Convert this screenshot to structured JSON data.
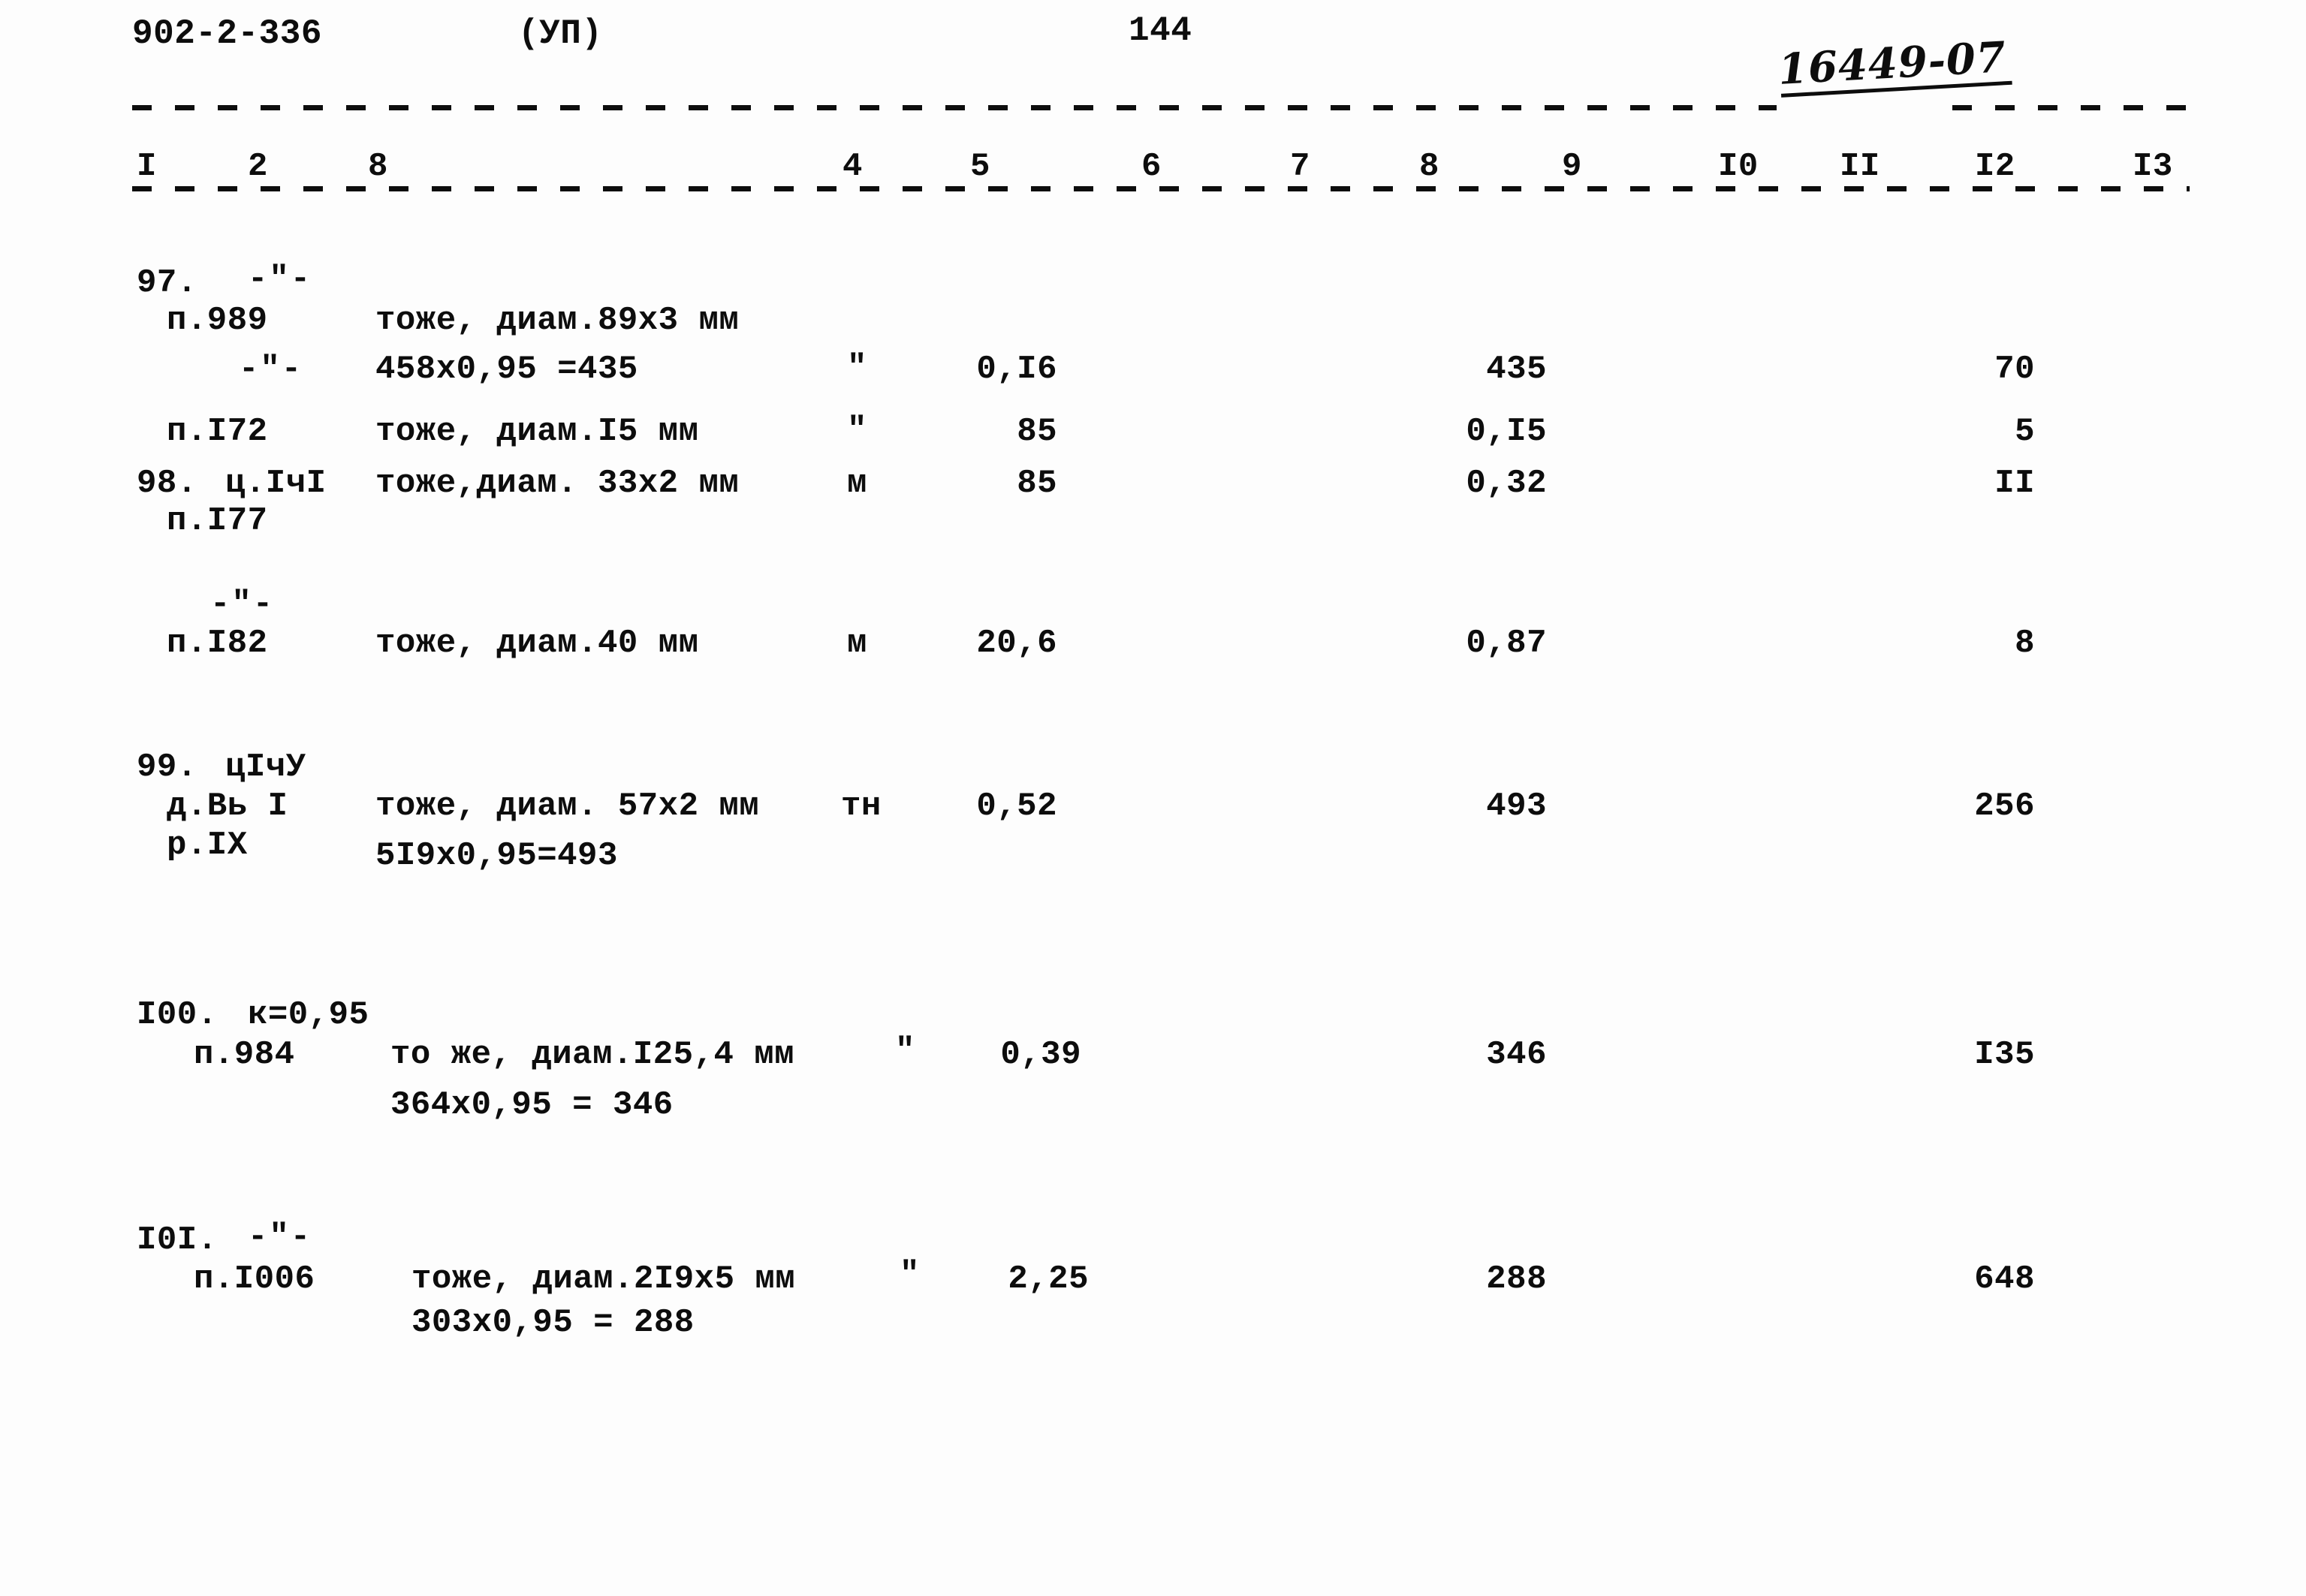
{
  "document": {
    "series_code": "902-2-336",
    "volume_marker": "(УП)",
    "page_number": "144",
    "archive_stamp": "16449-07"
  },
  "column_header": {
    "numbers": [
      "I",
      "2",
      "8",
      "4",
      "5",
      "6",
      "7",
      "8",
      "9",
      "I0",
      "II",
      "I2",
      "I3"
    ]
  },
  "rows": [
    {
      "id": "row-97",
      "item_no": "97.",
      "ref_top": "-\"-",
      "ref_code": "п.989",
      "description": "тоже, диам.89х3 мм",
      "unit": "",
      "qty": "",
      "col9": "",
      "col12": ""
    },
    {
      "id": "row-97b",
      "item_no": "",
      "ref_top": "",
      "ref_code": "-\"-",
      "description": "458х0,95 =435",
      "unit": "\"",
      "qty": "0,I6",
      "col9": "435",
      "col12": "70"
    },
    {
      "id": "row-97c",
      "item_no": "",
      "ref_top": "",
      "ref_code": "п.I72",
      "description": "тоже, диам.I5 мм",
      "unit": "\"",
      "qty": "85",
      "col9": "0,I5",
      "col12": "5"
    },
    {
      "id": "row-98",
      "item_no": "98.",
      "ref_top": "ц.IчI",
      "ref_code": "п.I77",
      "description": "тоже,диам. 33х2 мм",
      "unit": "м",
      "qty": "85",
      "col9": "0,32",
      "col12": "II"
    },
    {
      "id": "row-98b",
      "item_no": "",
      "ref_top": "-\"-",
      "ref_code": "п.I82",
      "description": "тоже, диам.40 мм",
      "unit": "м",
      "qty": "20,6",
      "col9": "0,87",
      "col12": "8"
    },
    {
      "id": "row-99",
      "item_no": "99.",
      "ref_top": "цIчУ",
      "ref_code_a": "д.Вь I",
      "ref_code_b": "р.IХ",
      "description": "тоже, диам. 57х2 мм",
      "description2": "5I9х0,95=493",
      "unit": "тн",
      "qty": "0,52",
      "col9": "493",
      "col12": "256"
    },
    {
      "id": "row-100",
      "item_no": "I00.",
      "ref_top": "к=0,95",
      "ref_code": "п.984",
      "description": "то же, диам.I25,4 мм",
      "description2": "364х0,95 = 346",
      "unit": "\"",
      "qty": "0,39",
      "col9": "346",
      "col12": "I35"
    },
    {
      "id": "row-101",
      "item_no": "I0I.",
      "ref_top": "-\"-",
      "ref_code": "п.I006",
      "description": "тоже, диам.2I9х5 мм",
      "description2": "303х0,95 = 288",
      "unit": "\"",
      "qty": "2,25",
      "col9": "288",
      "col12": "648"
    }
  ]
}
